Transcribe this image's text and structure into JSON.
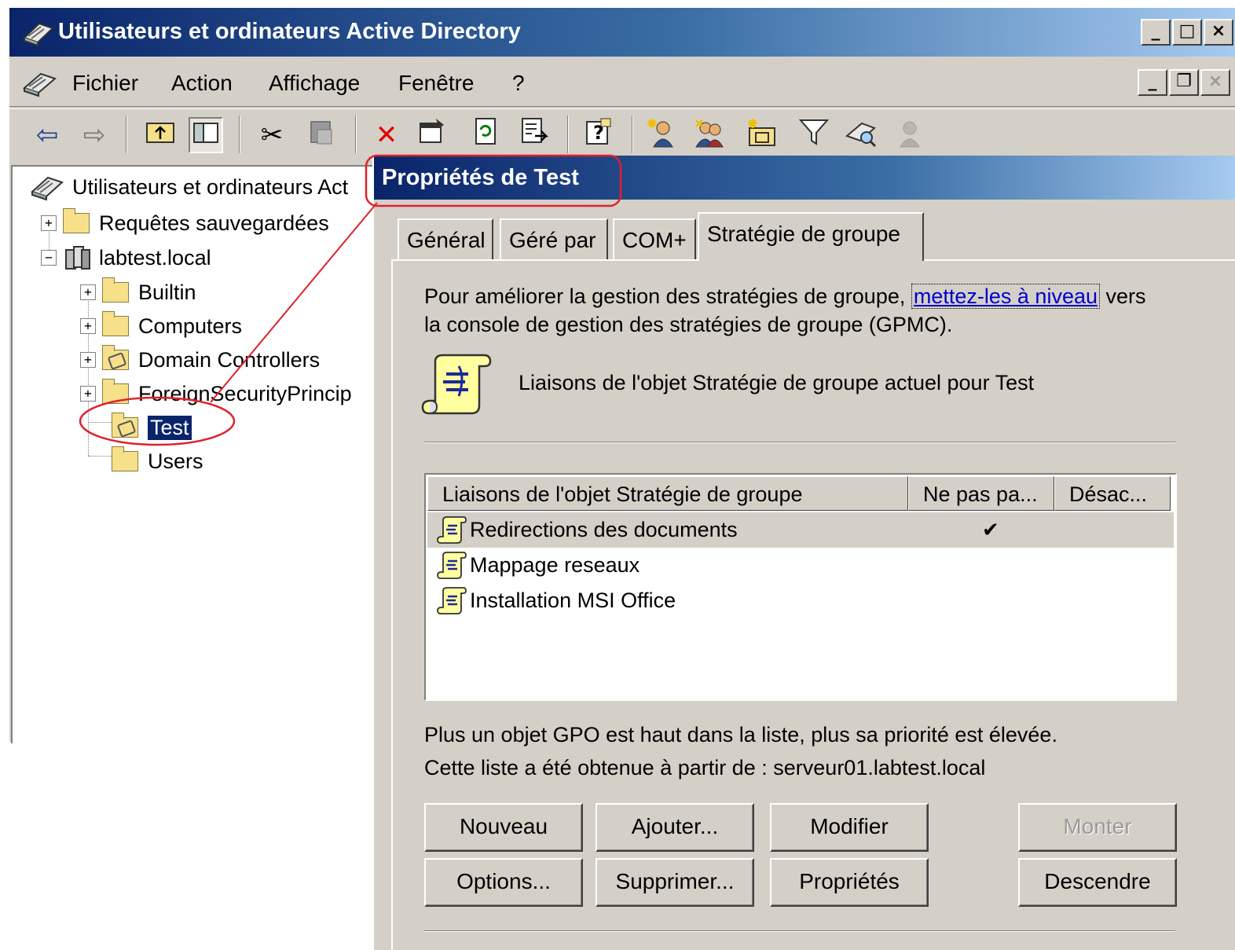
{
  "window": {
    "title": "Utilisateurs et ordinateurs Active Directory",
    "controls": [
      "_",
      "□",
      "×"
    ]
  },
  "menubar": {
    "items": [
      "Fichier",
      "Action",
      "Affichage",
      "Fenêtre",
      "?"
    ],
    "mdi_controls": [
      "_",
      "❐",
      "×"
    ]
  },
  "toolbar": {
    "icons": [
      "back-arrow-icon",
      "forward-arrow-icon",
      "up-folder-icon",
      "show-tree-icon",
      "cut-icon",
      "paste-icon",
      "delete-icon",
      "properties-icon",
      "refresh-icon",
      "export-list-icon",
      "help-icon",
      "new-user-icon",
      "new-group-icon",
      "new-ou-icon",
      "filter-icon",
      "find-icon",
      "add-to-group-icon"
    ]
  },
  "tree": {
    "root": "Utilisateurs et ordinateurs Act",
    "saved_queries": "Requêtes sauvegardées",
    "domain": "labtest.local",
    "children": [
      "Builtin",
      "Computers",
      "Domain Controllers",
      "ForeignSecurityPrincip",
      "Test",
      "Users"
    ],
    "selected": "Test"
  },
  "dialog": {
    "title": "Propriétés de Test",
    "tabs": [
      "Général",
      "Géré par",
      "COM+",
      "Stratégie de groupe"
    ],
    "active_tab": "Stratégie de groupe",
    "intro_before_link": "Pour améliorer la gestion des stratégies de groupe,",
    "intro_link": "mettez-les à niveau",
    "intro_after_link": "vers",
    "intro_line2": "la console de gestion des stratégies de groupe (GPMC).",
    "links_caption": "Liaisons de l'objet Stratégie de groupe actuel pour Test",
    "list": {
      "columns": [
        "Liaisons de l'objet Stratégie de groupe",
        "Ne pas pa...",
        "Désac..."
      ],
      "rows": [
        {
          "name": "Redirections des documents",
          "no_override": "✔",
          "disabled": ""
        },
        {
          "name": "Mappage reseaux",
          "no_override": "",
          "disabled": ""
        },
        {
          "name": "Installation MSI Office",
          "no_override": "",
          "disabled": ""
        }
      ]
    },
    "priority_note": "Plus un objet GPO est haut dans la liste, plus sa priorité est élevée.",
    "source_note": "Cette liste a été obtenue à partir de : serveur01.labtest.local",
    "buttons": {
      "new": "Nouveau",
      "add": "Ajouter...",
      "edit": "Modifier",
      "up": "Monter",
      "options": "Options...",
      "delete": "Supprimer...",
      "properties": "Propriétés",
      "down": "Descendre"
    }
  },
  "colors": {
    "title_dark": "#0a246a",
    "title_light": "#a6caf0",
    "face": "#d4d0c8",
    "annotation": "#e0202a",
    "link": "#0000cc"
  }
}
